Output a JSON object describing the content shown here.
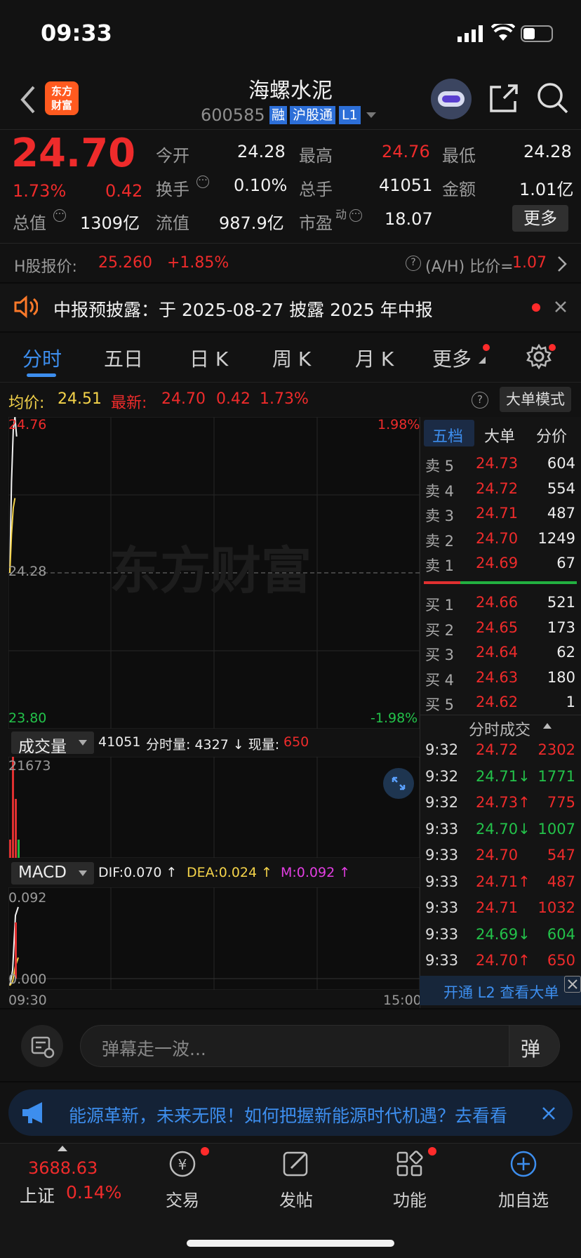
{
  "status_bar": {
    "time": "09:33"
  },
  "header": {
    "title": "海螺水泥",
    "code": "600585",
    "badges": [
      "融",
      "沪股通",
      "L1"
    ],
    "logo_text": [
      "东方",
      "财富"
    ]
  },
  "quote": {
    "price": "24.70",
    "pct": "1.73%",
    "chg": "0.42",
    "stats": [
      {
        "label": "今开",
        "value": "24.28"
      },
      {
        "label": "最高",
        "value": "24.76",
        "color": "red"
      },
      {
        "label": "最低",
        "value": "24.28"
      },
      {
        "label": "换手",
        "value": "0.10%"
      },
      {
        "label": "总手",
        "value": "41051"
      },
      {
        "label": "金额",
        "value": "1.01亿"
      },
      {
        "label": "总值",
        "value": "1309亿"
      },
      {
        "label": "流值",
        "value": "987.9亿"
      },
      {
        "label": "市盈",
        "sup": "动",
        "value": "18.07"
      }
    ],
    "more_label": "更多"
  },
  "h_share": {
    "label": "H股报价:",
    "price": "25.260",
    "chg": "+1.85%",
    "ah_label": "(A/H) 比价=",
    "ah_value": "1.07"
  },
  "notice": {
    "text": "中报预披露：于 2025-08-27 披露 2025 年中报"
  },
  "tabs": [
    "分时",
    "五日",
    "日 K",
    "周 K",
    "月 K",
    "更多"
  ],
  "avg_bar": {
    "avg_label": "均价:",
    "avg_value": "24.51",
    "latest_label": "最新:",
    "latest_price": "24.70",
    "latest_chg": "0.42",
    "latest_pct": "1.73%",
    "big_order_mode": "大单模式"
  },
  "chart": {
    "price_high": "24.76",
    "price_mid": "24.28",
    "price_low": "23.80",
    "pct_high": "1.98%",
    "pct_low": "-1.98%",
    "watermark": "东方财富",
    "volume_selector": "成交量",
    "volume_info_total": "41051",
    "volume_info_label": "分时量: 4327 ↓ 现量:",
    "volume_now": "650",
    "volume_max": "21673",
    "macd_selector": "MACD",
    "dif": "DIF:0.070 ↑",
    "dea": "DEA:0.024 ↑",
    "m": "M:0.092 ↑",
    "macd_max": "0.092",
    "macd_min": "0.000",
    "time_start": "09:30",
    "time_end": "15:00"
  },
  "chart_data": {
    "type": "line",
    "title": "",
    "y_range": [
      23.8,
      24.76
    ],
    "series": [
      {
        "name": "",
        "points": [
          [
            0,
            24.28
          ],
          [
            1,
            24.56
          ],
          [
            2,
            24.72
          ],
          [
            3,
            24.76
          ],
          [
            4,
            24.7
          ]
        ],
        "color": "#f2f2f2"
      },
      {
        "name": "均价",
        "points": [
          [
            0,
            24.28
          ],
          [
            1,
            24.4
          ],
          [
            2,
            24.48
          ],
          [
            3,
            24.51
          ]
        ],
        "color": "#f4d34a"
      }
    ]
  },
  "orderbook": {
    "tabs": [
      "五档",
      "大单",
      "分价"
    ],
    "asks": [
      {
        "label": "卖 5",
        "price": "24.73",
        "vol": "604"
      },
      {
        "label": "卖 4",
        "price": "24.72",
        "vol": "554"
      },
      {
        "label": "卖 3",
        "price": "24.71",
        "vol": "487"
      },
      {
        "label": "卖 2",
        "price": "24.70",
        "vol": "1249"
      },
      {
        "label": "卖 1",
        "price": "24.69",
        "vol": "67"
      }
    ],
    "bids": [
      {
        "label": "买 1",
        "price": "24.66",
        "vol": "521"
      },
      {
        "label": "买 2",
        "price": "24.65",
        "vol": "173"
      },
      {
        "label": "买 3",
        "price": "24.64",
        "vol": "62"
      },
      {
        "label": "买 4",
        "price": "24.63",
        "vol": "180"
      },
      {
        "label": "买 5",
        "price": "24.62",
        "vol": "1"
      }
    ],
    "trades_title": "分时成交",
    "trades": [
      {
        "time": "9:32",
        "price": "24.72",
        "vol": "2302",
        "color": "red"
      },
      {
        "time": "9:32",
        "price": "24.71↓",
        "vol": "1771",
        "color": "green"
      },
      {
        "time": "9:32",
        "price": "24.73↑",
        "vol": "775",
        "color": "red"
      },
      {
        "time": "9:33",
        "price": "24.70↓",
        "vol": "1007",
        "color": "green"
      },
      {
        "time": "9:33",
        "price": "24.70",
        "vol": "547",
        "color": "red"
      },
      {
        "time": "9:33",
        "price": "24.71↑",
        "vol": "487",
        "color": "red"
      },
      {
        "time": "9:33",
        "price": "24.71",
        "vol": "1032",
        "color": "red"
      },
      {
        "time": "9:33",
        "price": "24.69↓",
        "vol": "604",
        "color": "green"
      },
      {
        "time": "9:33",
        "price": "24.70↑",
        "vol": "650",
        "color": "red"
      }
    ],
    "l2_banner": "开通 L2 查看大单"
  },
  "danmaku": {
    "placeholder": "弹幕走一波..."
  },
  "ad": {
    "text": "能源革新，未来无限！如何把握新能源时代机遇？去看看"
  },
  "bottom": {
    "index_value": "3688.63",
    "index_name": "上证",
    "index_pct": "0.14%",
    "items": [
      {
        "label": "交易",
        "icon": "trade-icon"
      },
      {
        "label": "发帖",
        "icon": "post-icon"
      },
      {
        "label": "功能",
        "icon": "function-icon"
      },
      {
        "label": "加自选",
        "icon": "add-watchlist-icon"
      }
    ]
  }
}
